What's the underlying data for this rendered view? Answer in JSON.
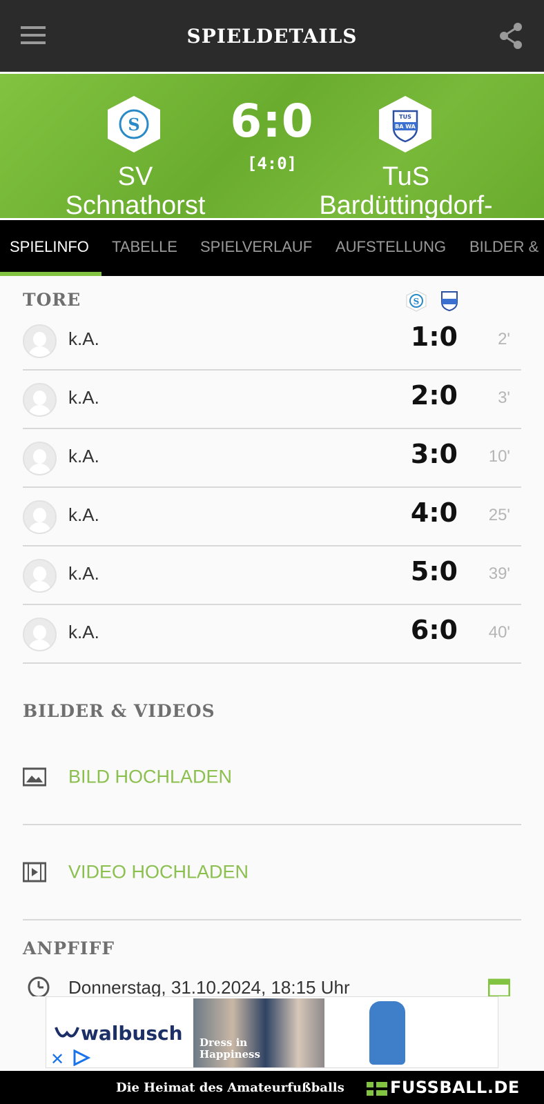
{
  "app_bar": {
    "title": "SPIELDETAILS",
    "menu_icon": "hamburger-menu-icon",
    "share_icon": "share-icon"
  },
  "match": {
    "home_team": "SV Schnathorst",
    "away_team": "TuS Bardüttingdorf-Wall...",
    "score": "6:0",
    "halftime": "[4:0]",
    "home_crest_icon": "sv-schnathorst-crest-icon",
    "away_crest_icon": "tus-bawa-crest-icon",
    "accent_color": "#82c341"
  },
  "tabs": [
    {
      "label": "SPIELINFO",
      "active": true
    },
    {
      "label": "TABELLE"
    },
    {
      "label": "SPIELVERLAUF"
    },
    {
      "label": "AUFSTELLUNG"
    },
    {
      "label": "BILDER &"
    }
  ],
  "goals": {
    "title": "TORE",
    "rows": [
      {
        "player": "k.A.",
        "score": "1:0",
        "minute": "2'"
      },
      {
        "player": "k.A.",
        "score": "2:0",
        "minute": "3'"
      },
      {
        "player": "k.A.",
        "score": "3:0",
        "minute": "10'"
      },
      {
        "player": "k.A.",
        "score": "4:0",
        "minute": "25'"
      },
      {
        "player": "k.A.",
        "score": "5:0",
        "minute": "39'"
      },
      {
        "player": "k.A.",
        "score": "6:0",
        "minute": "40'"
      }
    ]
  },
  "media": {
    "title": "BILDER & VIDEOS",
    "upload_image": "BILD HOCHLADEN",
    "upload_video": "VIDEO HOCHLADEN"
  },
  "kickoff": {
    "title": "ANPFIFF",
    "datetime": "Donnerstag, 31.10.2024, 18:15 Uhr"
  },
  "ad": {
    "brand": "walbusch",
    "tagline_line1": "Dress in",
    "tagline_line2": "Happiness",
    "close_label": "✕"
  },
  "footer": {
    "slogan": "Die Heimat des Amateurfußballs",
    "logo": "FUSSBALL.DE"
  }
}
